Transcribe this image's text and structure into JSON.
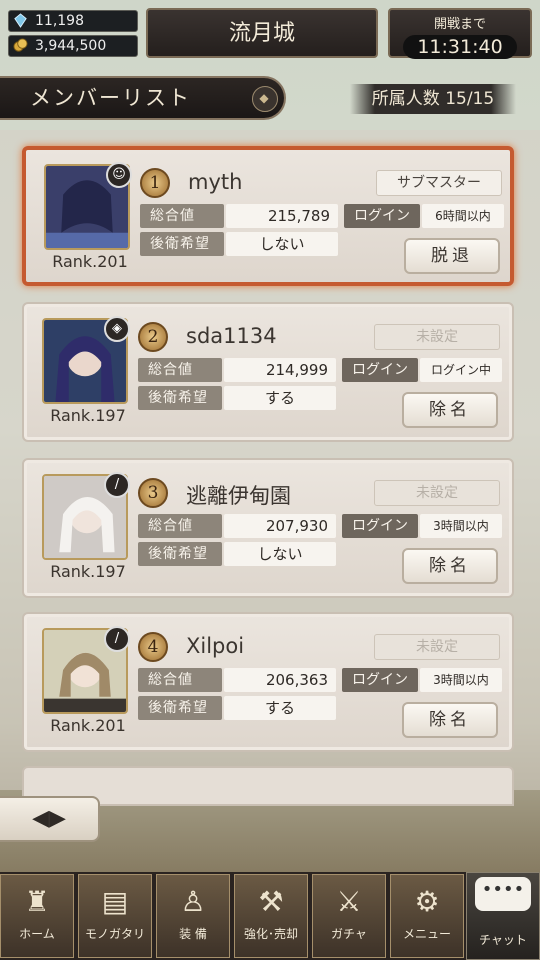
{
  "resources": {
    "gems": "11,198",
    "gold": "3,944,500"
  },
  "header": {
    "guild_name": "流月城",
    "timer_label": "開戦まで",
    "timer_value": "11:31:40"
  },
  "section": {
    "title": "メンバーリスト",
    "member_count": "所属人数 15/15"
  },
  "labels": {
    "total": "総合値",
    "rear": "後衛希望",
    "login": "ログイン"
  },
  "members": [
    {
      "rank_no": "1",
      "name": "myth",
      "role": "サブマスター",
      "total": "215,789",
      "rear": "しない",
      "login": "6時間以内",
      "rank": "Rank.201",
      "action": "脱退",
      "icon": "mask-icon"
    },
    {
      "rank_no": "2",
      "name": "sda1134",
      "role": "未設定",
      "total": "214,999",
      "rear": "する",
      "login": "ログイン中",
      "rank": "Rank.197",
      "action": "除名",
      "icon": "shield-icon"
    },
    {
      "rank_no": "3",
      "name": "逃離伊甸園",
      "role": "未設定",
      "total": "207,930",
      "rear": "しない",
      "login": "3時間以内",
      "rank": "Rank.197",
      "action": "除名",
      "icon": "sword-icon"
    },
    {
      "rank_no": "4",
      "name": "Xilpoi",
      "role": "未設定",
      "total": "206,363",
      "rear": "する",
      "login": "3時間以内",
      "rank": "Rank.201",
      "action": "除名",
      "icon": "sword-icon"
    }
  ],
  "nav": [
    {
      "label": "ホーム",
      "icon": "castle-icon"
    },
    {
      "label": "モノガタリ",
      "icon": "book-icon"
    },
    {
      "label": "装 備",
      "icon": "armor-icon"
    },
    {
      "label": "強化･売却",
      "icon": "forge-icon"
    },
    {
      "label": "ガチャ",
      "icon": "crossed-swords-icon"
    },
    {
      "label": "メニュー",
      "icon": "gears-icon"
    }
  ],
  "chat": {
    "label": "チャット",
    "icon": "chat-bubble-icon"
  }
}
